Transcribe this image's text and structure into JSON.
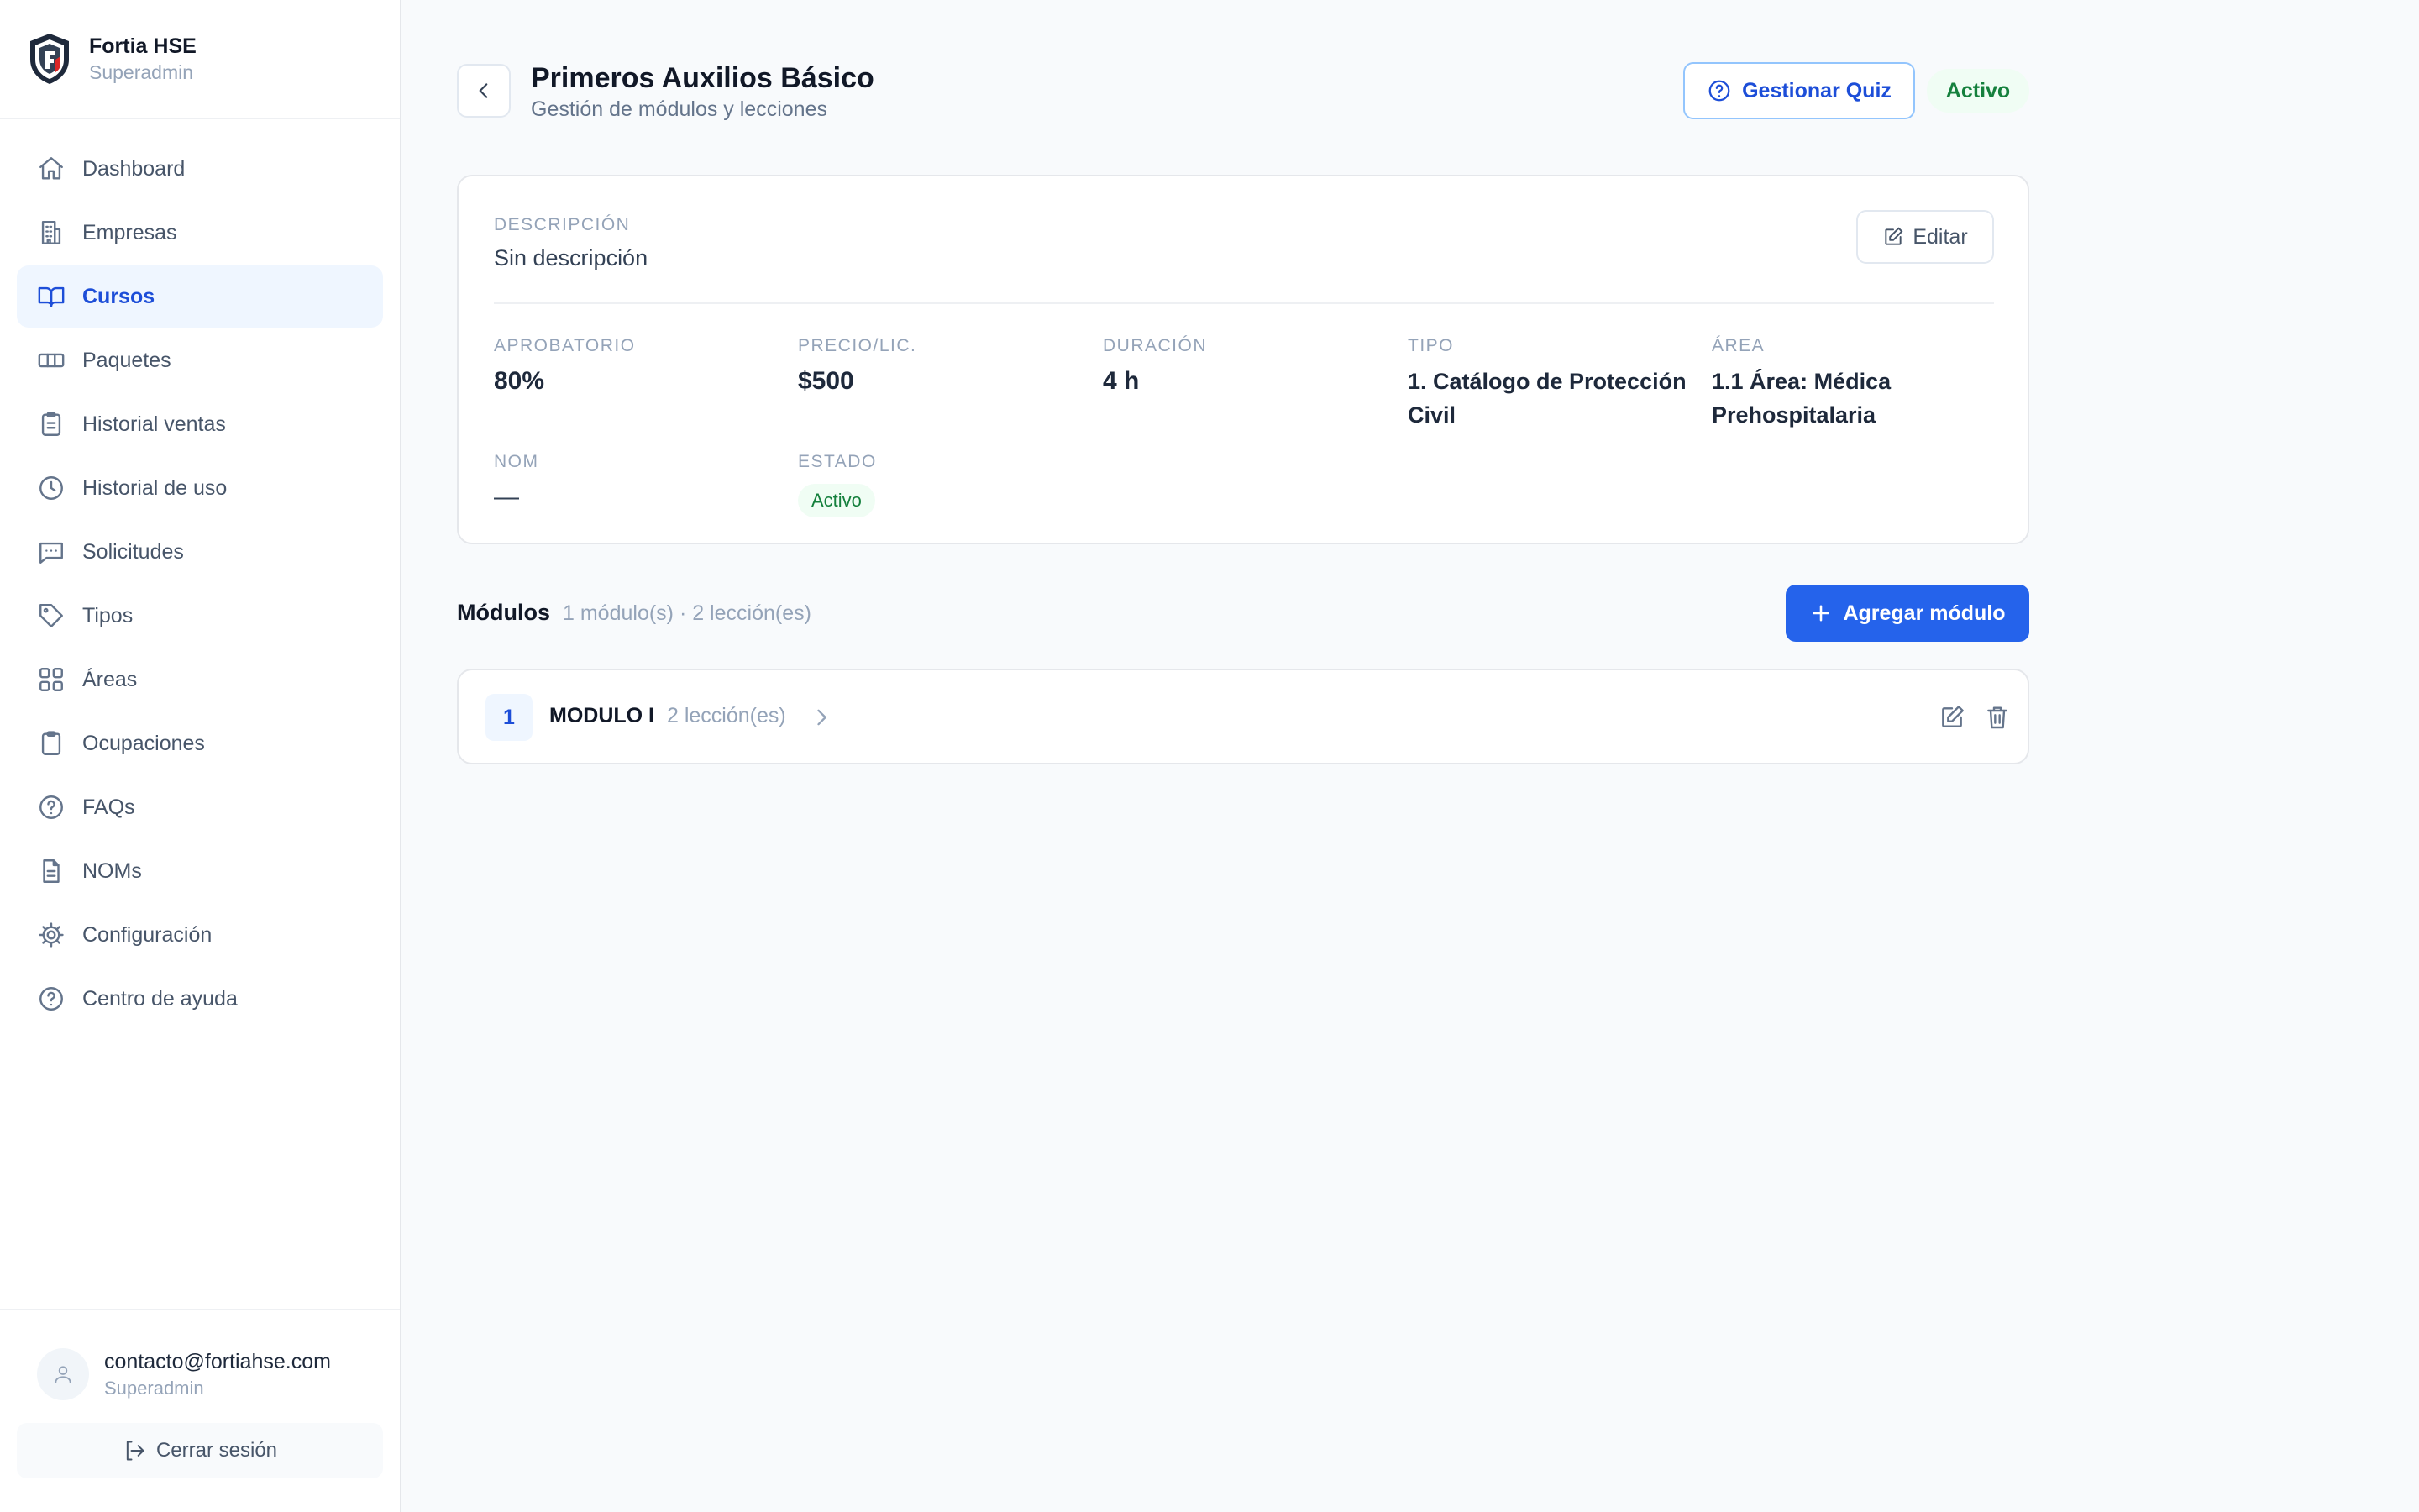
{
  "brand": {
    "name": "Fortia HSE",
    "role": "Superadmin"
  },
  "sidebar": {
    "items": [
      {
        "label": "Dashboard",
        "icon": "home-icon"
      },
      {
        "label": "Empresas",
        "icon": "building-icon"
      },
      {
        "label": "Cursos",
        "icon": "book-icon",
        "active": true
      },
      {
        "label": "Paquetes",
        "icon": "ticket-icon"
      },
      {
        "label": "Historial ventas",
        "icon": "clipboard-list-icon"
      },
      {
        "label": "Historial de uso",
        "icon": "clock-icon"
      },
      {
        "label": "Solicitudes",
        "icon": "message-icon"
      },
      {
        "label": "Tipos",
        "icon": "tag-icon"
      },
      {
        "label": "Áreas",
        "icon": "grid-icon"
      },
      {
        "label": "Ocupaciones",
        "icon": "clipboard-icon"
      },
      {
        "label": "FAQs",
        "icon": "help-circle-icon"
      },
      {
        "label": "NOMs",
        "icon": "file-text-icon"
      },
      {
        "label": "Configuración",
        "icon": "gear-icon"
      },
      {
        "label": "Centro de ayuda",
        "icon": "help-circle-icon"
      }
    ]
  },
  "user": {
    "email": "contacto@fortiahse.com",
    "role": "Superadmin",
    "logout_label": "Cerrar sesión"
  },
  "header": {
    "title": "Primeros Auxilios Básico",
    "subtitle": "Gestión de módulos y lecciones",
    "quiz_label": "Gestionar Quiz",
    "status": "Activo"
  },
  "details": {
    "description_label": "DESCRIPCIÓN",
    "description_value": "Sin descripción",
    "edit_label": "Editar",
    "fields": {
      "aprobatorio": {
        "label": "APROBATORIO",
        "value": "80%"
      },
      "precio": {
        "label": "PRECIO/LIC.",
        "value": "$500"
      },
      "duracion": {
        "label": "DURACIÓN",
        "value": "4 h"
      },
      "tipo": {
        "label": "TIPO",
        "value": "1. Catálogo de Protección Civil"
      },
      "area": {
        "label": "ÁREA",
        "value": "1.1 Área: Médica Prehospitalaria"
      },
      "nom": {
        "label": "NOM",
        "value": "—"
      },
      "estado": {
        "label": "ESTADO",
        "value": "Activo"
      }
    }
  },
  "modules": {
    "title": "Módulos",
    "meta": "1 módulo(s) · 2 lección(es)",
    "add_label": "Agregar módulo",
    "items": [
      {
        "number": "1",
        "name": "MODULO I",
        "lessons": "2 lección(es)"
      }
    ]
  },
  "colors": {
    "accent": "#2563eb",
    "active_bg": "#eff6ff",
    "success": "#15803d",
    "success_bg": "#f0fdf4"
  }
}
